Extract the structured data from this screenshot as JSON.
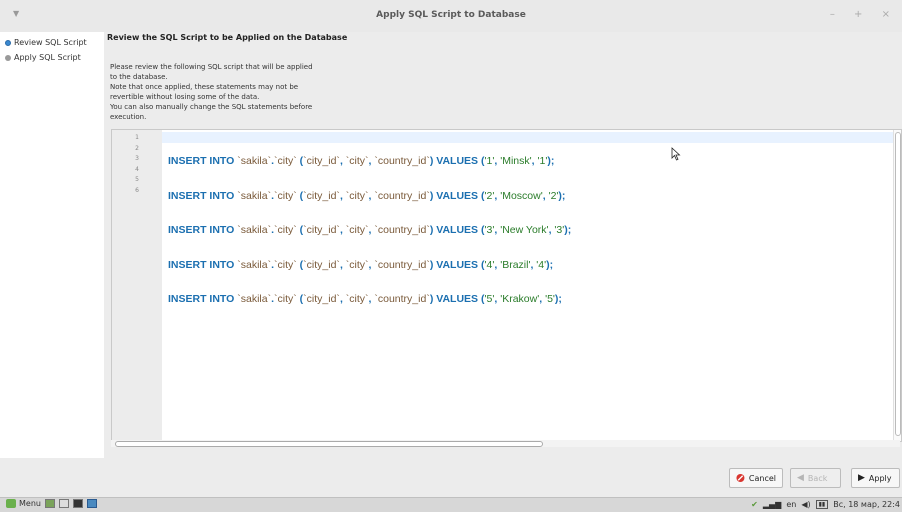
{
  "window": {
    "title": "Apply SQL Script to Database",
    "controls": [
      "–",
      "+",
      "×"
    ]
  },
  "sidebar": {
    "items": [
      {
        "label": "Review SQL Script",
        "color": "#3a88d0"
      },
      {
        "label": "Apply SQL Script",
        "color": "#888888"
      }
    ]
  },
  "main": {
    "heading": "Review the SQL Script to be Applied on the Database",
    "description": [
      "Please review the following SQL script that will be applied",
      "to the database.",
      "Note that once applied, these statements may not be",
      "revertible without losing some of the data.",
      "You can also manually change the SQL statements before",
      "execution."
    ]
  },
  "editor": {
    "line_numbers": [
      "1",
      "2",
      "3",
      "4",
      "5",
      "6"
    ],
    "lines": [
      "INSERT INTO `sakila`.`city` (`city_id`, `city`, `country_id`) VALUES ('1', 'Minsk', '1');",
      "INSERT INTO `sakila`.`city` (`city_id`, `city`, `country_id`) VALUES ('2', 'Moscow', '2');",
      "INSERT INTO `sakila`.`city` (`city_id`, `city`, `country_id`) VALUES ('3', 'New York', '3');",
      "INSERT INTO `sakila`.`city` (`city_id`, `city`, `country_id`) VALUES ('4', 'Brazil', '4');",
      "INSERT INTO `sakila`.`city` (`city_id`, `city`, `country_id`) VALUES ('5', 'Krakow', '5');",
      ""
    ]
  },
  "buttons": {
    "cancel": "Cancel",
    "back": "Back",
    "apply": "Apply"
  },
  "taskbar": {
    "menu": "Menu",
    "lang": "en",
    "clock": "Вс, 18 мар, 22:4"
  }
}
